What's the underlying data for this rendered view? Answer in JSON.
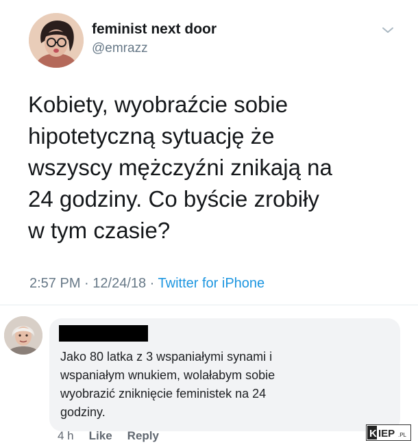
{
  "tweet": {
    "author_name": "feminist next door",
    "author_handle": "@emrazz",
    "text_lines": [
      "Kobiety, wyobraźcie sobie",
      "hipotetyczną sytuację że",
      "wszyscy mężczyźni znikają na",
      "24 godziny. Co byście zrobiły",
      "w tym czasie?"
    ],
    "time": "2:57 PM",
    "date": "12/24/18",
    "separator": " · ",
    "source": "Twitter for iPhone",
    "menu_icon": "chevron-down-icon"
  },
  "comment": {
    "text_lines": [
      "Jako 80 latka z 3 wspaniałymi synami i",
      "wspaniałym wnukiem, wolałabym sobie",
      "wyobrazić zniknięcie feministek na 24",
      "godziny."
    ],
    "time_ago": "4 h",
    "like_label": "Like",
    "reply_label": "Reply"
  },
  "watermark": {
    "text": "KIEP.PL"
  },
  "colors": {
    "tweet_text": "#14171a",
    "tweet_meta": "#657786",
    "twitter_blue": "#1b95e0",
    "comment_bubble": "#f2f3f5",
    "comment_meta": "#606770"
  }
}
